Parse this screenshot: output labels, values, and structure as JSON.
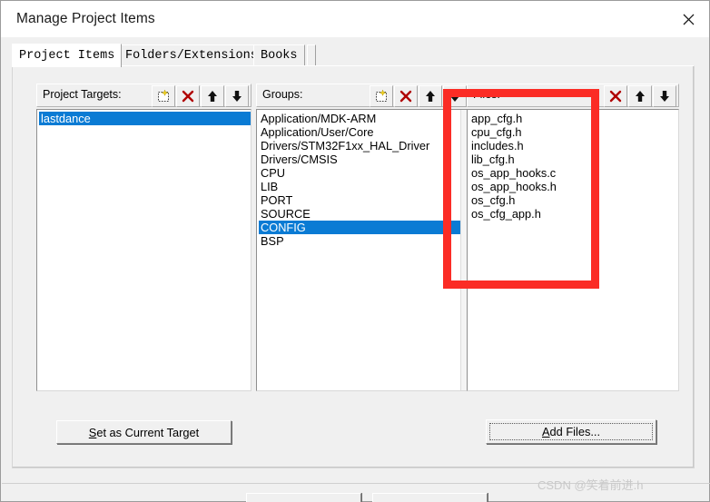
{
  "window": {
    "title": "Manage Project Items",
    "close_icon": "close-icon"
  },
  "tabs": [
    {
      "label": "Project Items",
      "active": true
    },
    {
      "label": "Folders/Extensions",
      "active": false
    },
    {
      "label": "Books",
      "active": false
    }
  ],
  "columns": {
    "project_targets": {
      "label": "Project Targets:",
      "buttons": [
        {
          "icon": "new-item-icon",
          "name": "new-target-button"
        },
        {
          "icon": "delete-x-icon",
          "name": "delete-target-button"
        },
        {
          "icon": "arrow-up-icon",
          "name": "move-target-up-button"
        },
        {
          "icon": "arrow-down-icon",
          "name": "move-target-down-button"
        }
      ],
      "items": [
        {
          "label": "lastdance",
          "selected": true
        }
      ]
    },
    "groups": {
      "label": "Groups:",
      "buttons": [
        {
          "icon": "new-item-icon",
          "name": "new-group-button"
        },
        {
          "icon": "delete-x-icon",
          "name": "delete-group-button"
        },
        {
          "icon": "arrow-up-icon",
          "name": "move-group-up-button"
        },
        {
          "icon": "arrow-down-icon",
          "name": "move-group-down-button"
        }
      ],
      "items": [
        {
          "label": "Application/MDK-ARM",
          "selected": false
        },
        {
          "label": "Application/User/Core",
          "selected": false
        },
        {
          "label": "Drivers/STM32F1xx_HAL_Driver",
          "selected": false
        },
        {
          "label": "Drivers/CMSIS",
          "selected": false
        },
        {
          "label": "CPU",
          "selected": false
        },
        {
          "label": "LIB",
          "selected": false
        },
        {
          "label": "PORT",
          "selected": false
        },
        {
          "label": "SOURCE",
          "selected": false
        },
        {
          "label": "CONFIG",
          "selected": true
        },
        {
          "label": "BSP",
          "selected": false
        }
      ]
    },
    "files": {
      "label": "Files:",
      "buttons": [
        {
          "icon": "delete-x-icon",
          "name": "delete-file-button"
        },
        {
          "icon": "arrow-up-icon",
          "name": "move-file-up-button"
        },
        {
          "icon": "arrow-down-icon",
          "name": "move-file-down-button"
        }
      ],
      "items": [
        {
          "label": "app_cfg.h",
          "selected": false
        },
        {
          "label": "cpu_cfg.h",
          "selected": false
        },
        {
          "label": "includes.h",
          "selected": false
        },
        {
          "label": "lib_cfg.h",
          "selected": false
        },
        {
          "label": "os_app_hooks.c",
          "selected": false
        },
        {
          "label": "os_app_hooks.h",
          "selected": false
        },
        {
          "label": "os_cfg.h",
          "selected": false
        },
        {
          "label": "os_cfg_app.h",
          "selected": false
        }
      ]
    }
  },
  "actions": {
    "set_current_target": {
      "accel": "S",
      "rest": "et as Current Target"
    },
    "add_files": {
      "accel": "A",
      "rest": "dd Files..."
    }
  },
  "annotation": {
    "color": "#fb2c25"
  },
  "watermark": {
    "text": "CSDN @笑着前进.h"
  },
  "colors": {
    "selection": "#0a7bd4",
    "dialog_face": "#f0f0f0",
    "annotation_red": "#fb2c25"
  }
}
